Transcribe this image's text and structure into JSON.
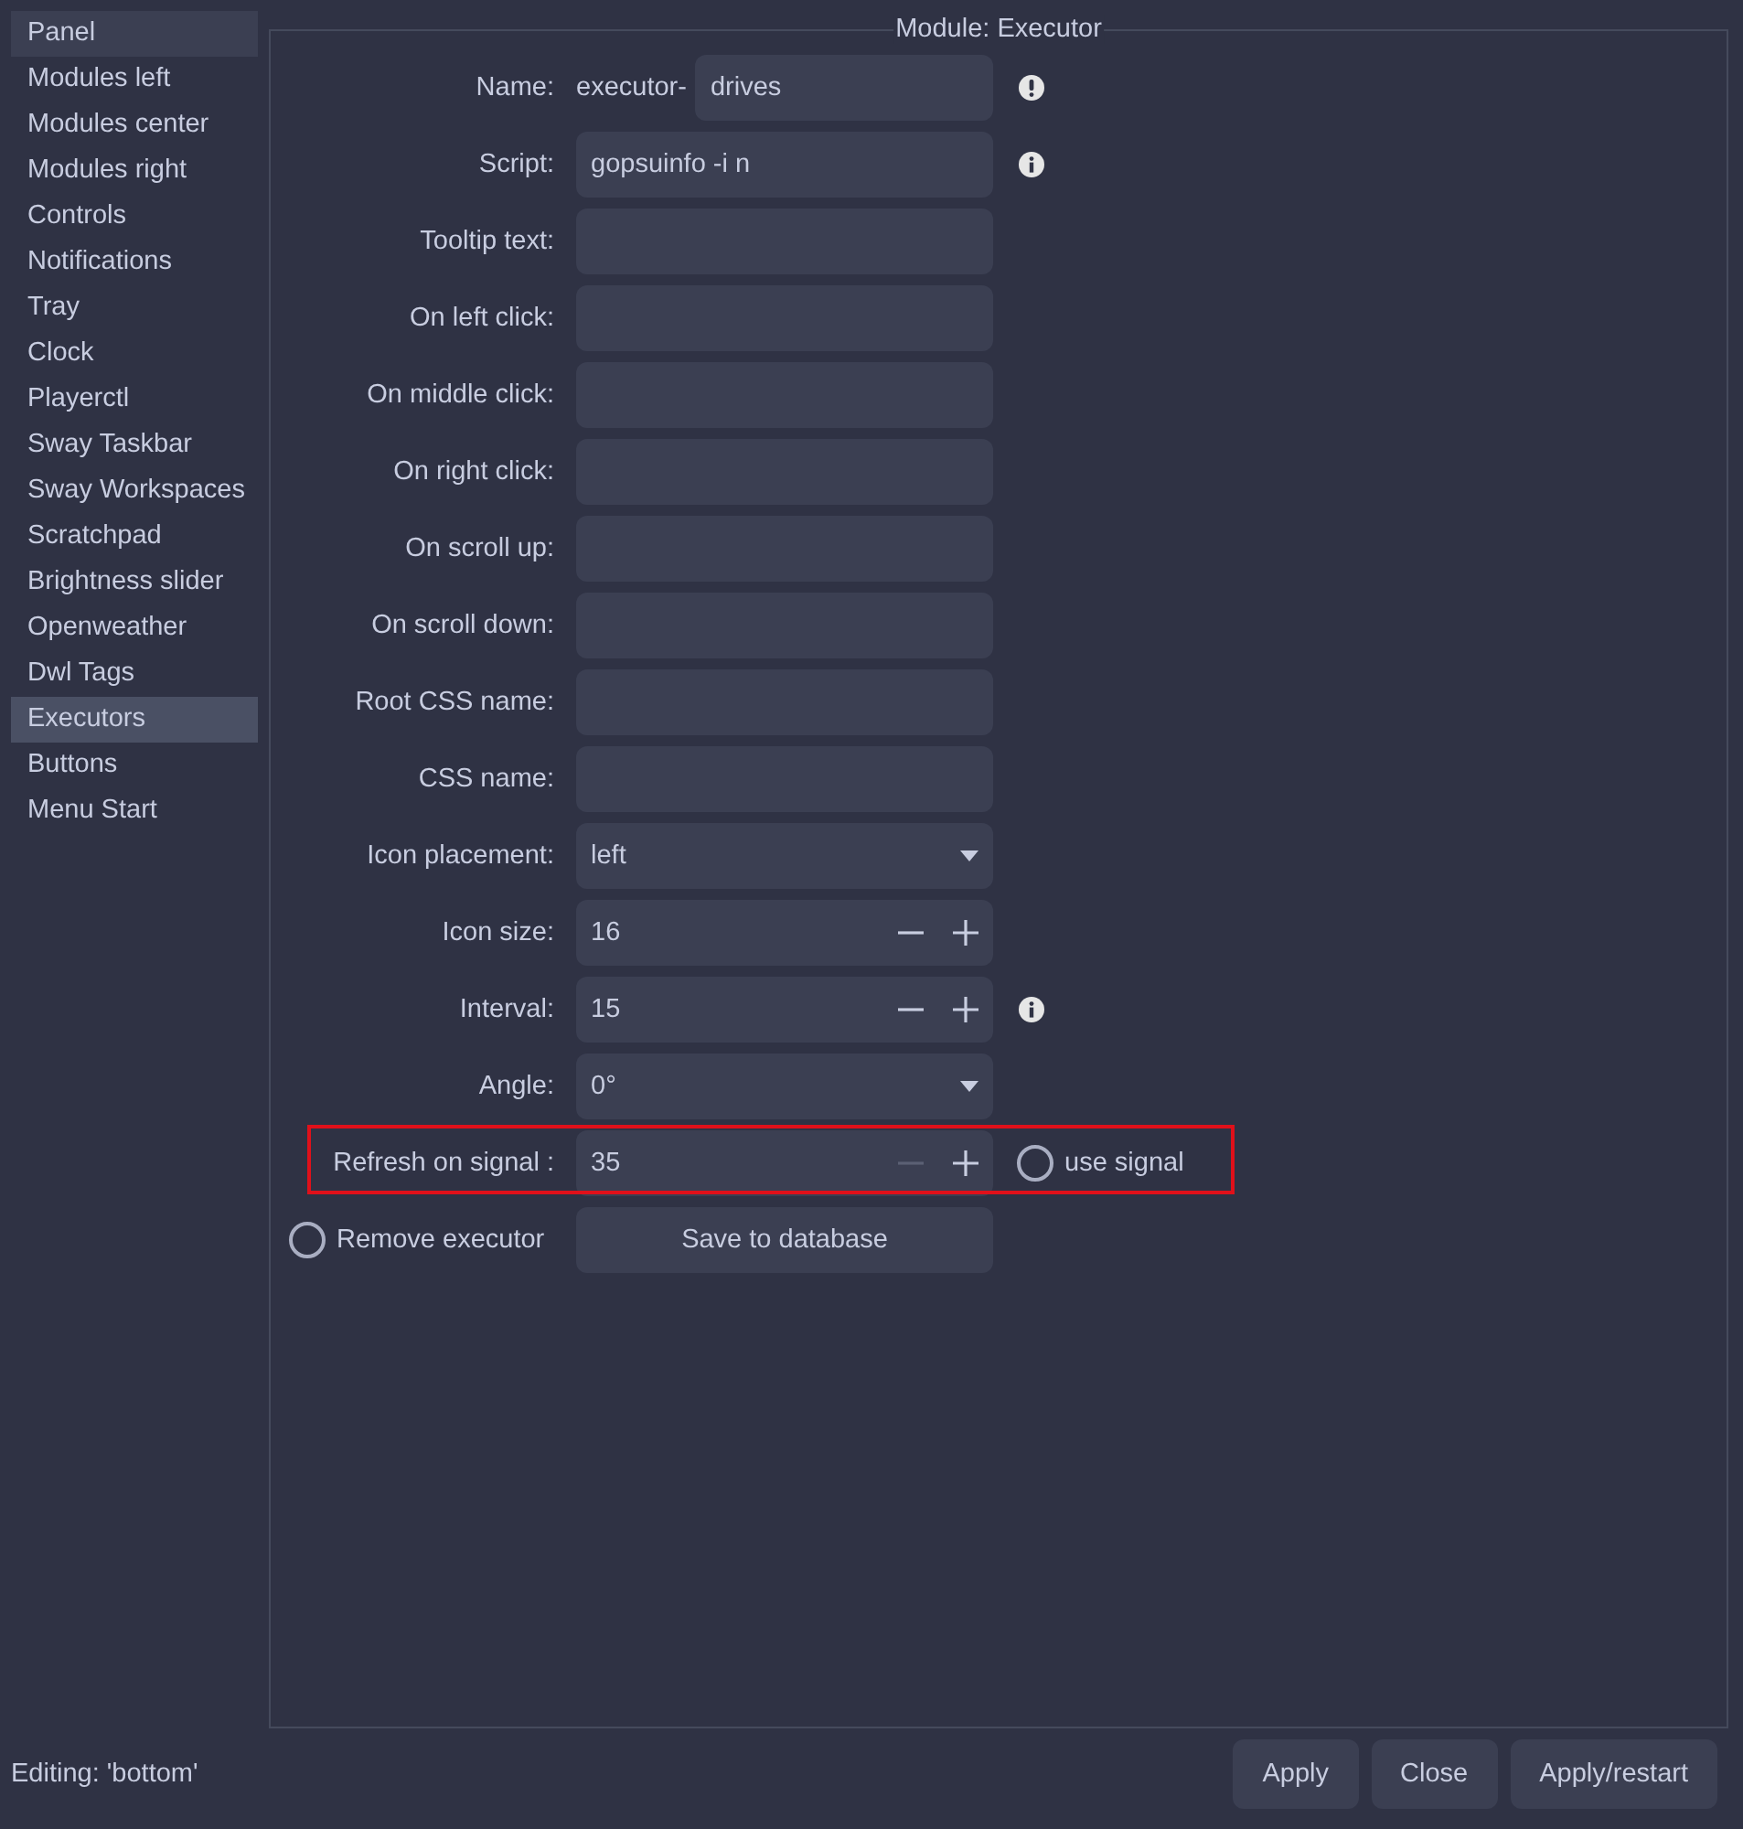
{
  "sidebar": {
    "items": [
      {
        "label": "Panel",
        "selected": false,
        "hovered": true
      },
      {
        "label": "Modules left",
        "selected": false,
        "hovered": false
      },
      {
        "label": "Modules center",
        "selected": false,
        "hovered": false
      },
      {
        "label": "Modules right",
        "selected": false,
        "hovered": false
      },
      {
        "label": "Controls",
        "selected": false,
        "hovered": false
      },
      {
        "label": "Notifications",
        "selected": false,
        "hovered": false
      },
      {
        "label": "Tray",
        "selected": false,
        "hovered": false
      },
      {
        "label": "Clock",
        "selected": false,
        "hovered": false
      },
      {
        "label": "Playerctl",
        "selected": false,
        "hovered": false
      },
      {
        "label": "Sway Taskbar",
        "selected": false,
        "hovered": false
      },
      {
        "label": "Sway Workspaces",
        "selected": false,
        "hovered": false
      },
      {
        "label": "Scratchpad",
        "selected": false,
        "hovered": false
      },
      {
        "label": "Brightness slider",
        "selected": false,
        "hovered": false
      },
      {
        "label": "Openweather",
        "selected": false,
        "hovered": false
      },
      {
        "label": "Dwl Tags",
        "selected": false,
        "hovered": false
      },
      {
        "label": "Executors",
        "selected": true,
        "hovered": false
      },
      {
        "label": "Buttons",
        "selected": false,
        "hovered": false
      },
      {
        "label": "Menu Start",
        "selected": false,
        "hovered": false
      }
    ]
  },
  "frame": {
    "title": "Module: Executor",
    "rows": [
      {
        "kind": "prefixed",
        "label": "Name:",
        "prefix": "executor-",
        "value": "drives",
        "warning": true
      },
      {
        "kind": "entry",
        "label": "Script:",
        "value": "gopsuinfo -i n",
        "info": true
      },
      {
        "kind": "entry",
        "label": "Tooltip text:"
      },
      {
        "kind": "entry",
        "label": "On left click:"
      },
      {
        "kind": "entry",
        "label": "On middle click:"
      },
      {
        "kind": "entry",
        "label": "On right click:"
      },
      {
        "kind": "entry",
        "label": "On scroll up:"
      },
      {
        "kind": "entry",
        "label": "On scroll down:"
      },
      {
        "kind": "entry",
        "label": "Root CSS name:"
      },
      {
        "kind": "entry",
        "label": "CSS name:"
      },
      {
        "kind": "dropdown",
        "label": "Icon placement:",
        "value": "left"
      },
      {
        "kind": "spin",
        "label": "Icon size:",
        "value": "16",
        "minus_disabled": false
      },
      {
        "kind": "spin",
        "label": "Interval:",
        "value": "15",
        "minus_disabled": false,
        "info": true
      },
      {
        "kind": "dropdown",
        "label": "Angle:",
        "value": "0°"
      },
      {
        "kind": "spin",
        "label": "Refresh on signal :",
        "value": "35",
        "minus_disabled": true,
        "highlighted": true,
        "check": {
          "label": "use signal",
          "checked": false
        }
      }
    ],
    "remove": {
      "label": "Remove executor",
      "checked": false
    },
    "save_button": "Save to database"
  },
  "status_bar": {
    "text": "Editing: 'bottom'",
    "buttons": [
      "Apply",
      "Close",
      "Apply/restart"
    ]
  }
}
